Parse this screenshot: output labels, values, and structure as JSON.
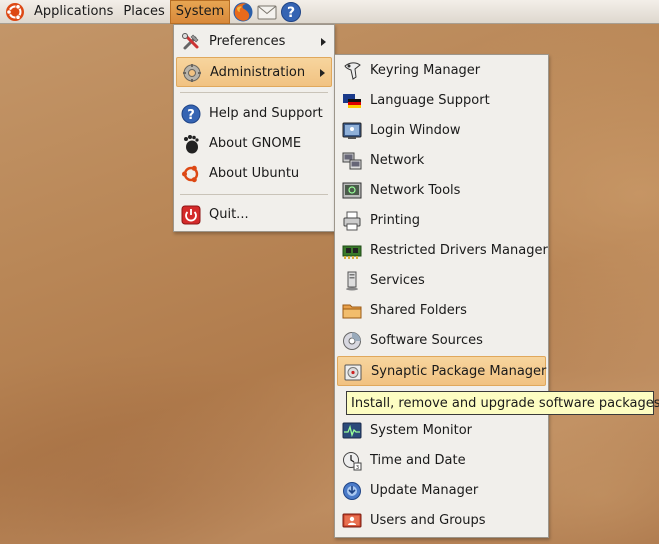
{
  "panel": {
    "menus": [
      "Applications",
      "Places",
      "System"
    ],
    "launchers": [
      "firefox-icon",
      "mail-icon",
      "help-icon"
    ]
  },
  "system_menu": {
    "items": [
      {
        "label": "Preferences",
        "icon": "preferences-icon",
        "submenu": true
      },
      {
        "label": "Administration",
        "icon": "administration-icon",
        "submenu": true,
        "highlighted": true
      },
      {
        "label": "Help and Support",
        "icon": "help-icon"
      },
      {
        "label": "About GNOME",
        "icon": "gnome-foot-icon"
      },
      {
        "label": "About Ubuntu",
        "icon": "ubuntu-icon"
      },
      {
        "label": "Quit...",
        "icon": "quit-icon"
      }
    ]
  },
  "admin_menu": {
    "items": [
      {
        "label": "Keyring Manager",
        "icon": "keyring-icon"
      },
      {
        "label": "Language Support",
        "icon": "language-flag-icon"
      },
      {
        "label": "Login Window",
        "icon": "login-window-icon"
      },
      {
        "label": "Network",
        "icon": "network-icon"
      },
      {
        "label": "Network Tools",
        "icon": "network-tools-icon"
      },
      {
        "label": "Printing",
        "icon": "printer-icon"
      },
      {
        "label": "Restricted Drivers Manager",
        "icon": "driver-card-icon"
      },
      {
        "label": "Services",
        "icon": "services-icon"
      },
      {
        "label": "Shared Folders",
        "icon": "shared-folder-icon"
      },
      {
        "label": "Software Sources",
        "icon": "software-sources-icon"
      },
      {
        "label": "Synaptic Package Manager",
        "icon": "synaptic-icon",
        "highlighted": true
      },
      {
        "label": "",
        "icon": "hidden-item-icon"
      },
      {
        "label": "System Monitor",
        "icon": "system-monitor-icon"
      },
      {
        "label": "Time and Date",
        "icon": "time-date-icon"
      },
      {
        "label": "Update Manager",
        "icon": "update-manager-icon"
      },
      {
        "label": "Users and Groups",
        "icon": "users-groups-icon"
      }
    ]
  },
  "tooltip": {
    "text": "Install, remove and upgrade software packages"
  },
  "colors": {
    "highlight": "#f1c282",
    "panel": "#e8e3db",
    "menu_bg": "#f1efeb",
    "tooltip_bg": "#fdfdc2",
    "desktop": "#b98757"
  }
}
